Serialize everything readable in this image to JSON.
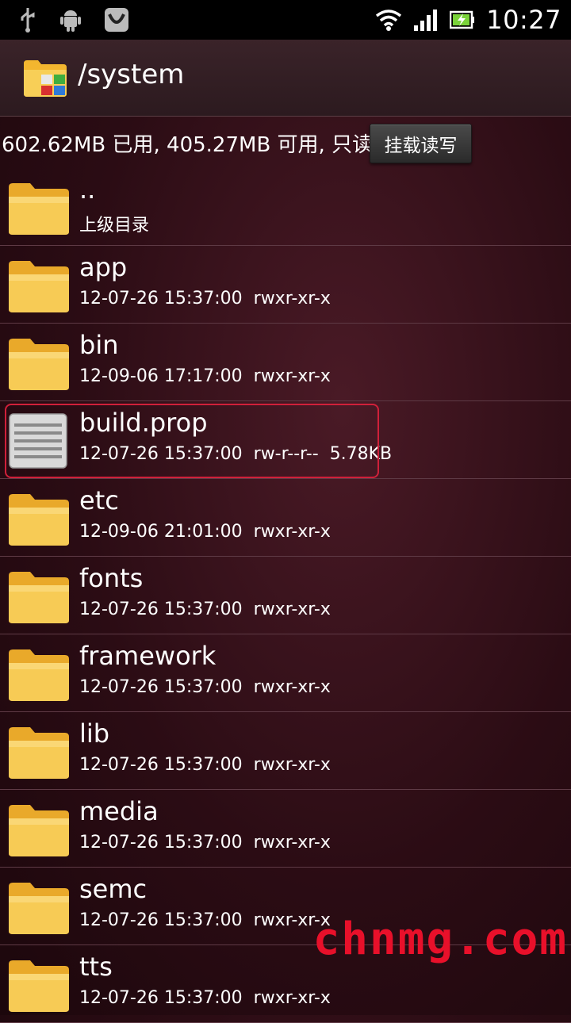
{
  "status_bar": {
    "left_icons": [
      "usb-icon",
      "android-icon",
      "download-icon"
    ],
    "right_icons": [
      "wifi-icon",
      "signal-icon",
      "battery-icon"
    ],
    "time": "10:27"
  },
  "header": {
    "icon": "folder-app-icon",
    "title": "/system"
  },
  "storage": {
    "text": "602.62MB 已用, 405.27MB 可用, 只读",
    "mount_button": "挂载读写"
  },
  "files": [
    {
      "name": "..",
      "meta": "上级目录",
      "type": "folder"
    },
    {
      "name": "app",
      "meta": "12-07-26 15:37:00  rwxr-xr-x",
      "type": "folder"
    },
    {
      "name": "bin",
      "meta": "12-09-06 17:17:00  rwxr-xr-x",
      "type": "folder"
    },
    {
      "name": "build.prop",
      "meta": "12-07-26 15:37:00  rw-r--r--  5.78KB",
      "type": "file",
      "selected": true
    },
    {
      "name": "etc",
      "meta": "12-09-06 21:01:00  rwxr-xr-x",
      "type": "folder"
    },
    {
      "name": "fonts",
      "meta": "12-07-26 15:37:00  rwxr-xr-x",
      "type": "folder"
    },
    {
      "name": "framework",
      "meta": "12-07-26 15:37:00  rwxr-xr-x",
      "type": "folder"
    },
    {
      "name": "lib",
      "meta": "12-07-26 15:37:00  rwxr-xr-x",
      "type": "folder"
    },
    {
      "name": "media",
      "meta": "12-07-26 15:37:00  rwxr-xr-x",
      "type": "folder"
    },
    {
      "name": "semc",
      "meta": "12-07-26 15:37:00  rwxr-xr-x",
      "type": "folder"
    },
    {
      "name": "tts",
      "meta": "12-07-26 15:37:00  rwxr-xr-x",
      "type": "folder"
    }
  ],
  "watermark": "chnmg.com",
  "colors": {
    "background": "#2b0c14",
    "folder": "#f5c64a",
    "selection": "#d0203a"
  }
}
